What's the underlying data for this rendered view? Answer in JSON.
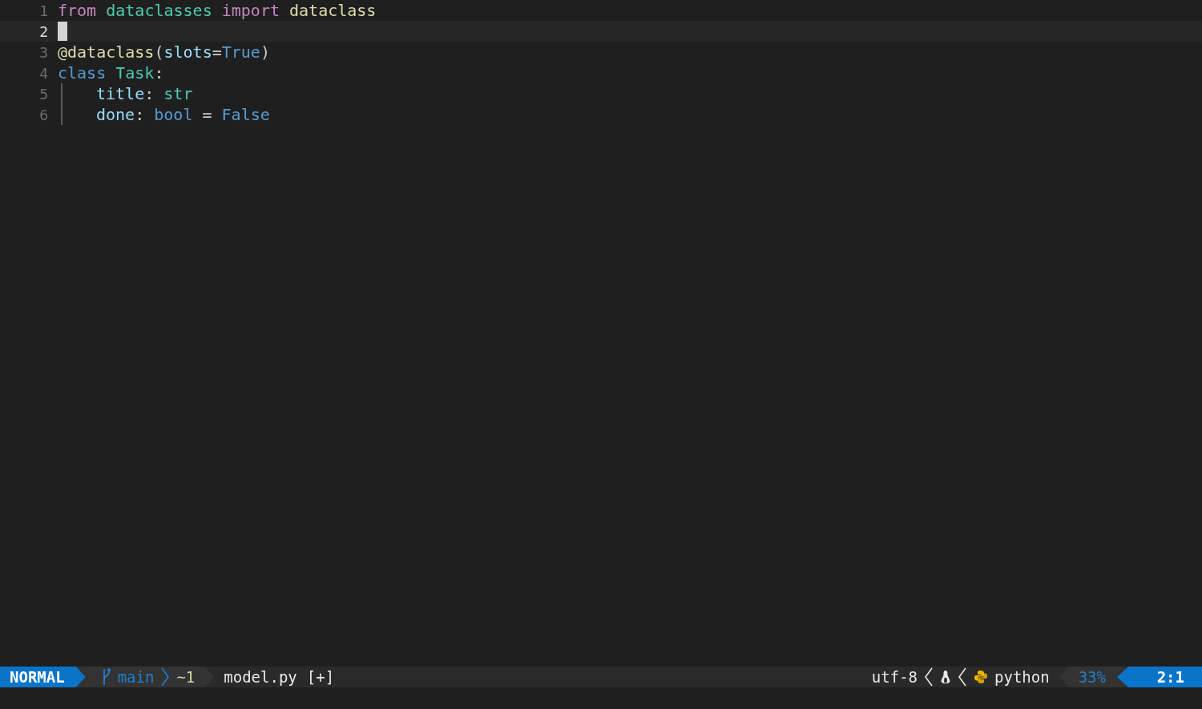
{
  "lines": [
    {
      "number": "1",
      "current": false,
      "indented": false,
      "tokens": [
        {
          "text": "from ",
          "kind": "keyword"
        },
        {
          "text": "dataclasses ",
          "kind": "module"
        },
        {
          "text": "import ",
          "kind": "keyword"
        },
        {
          "text": "dataclass",
          "kind": "function"
        }
      ]
    },
    {
      "number": "2",
      "current": true,
      "indented": false
    },
    {
      "number": "3",
      "current": false,
      "indented": false,
      "tokens": [
        {
          "text": "@dataclass",
          "kind": "function"
        },
        {
          "text": "(",
          "kind": "plain"
        },
        {
          "text": "slots",
          "kind": "variable"
        },
        {
          "text": "=",
          "kind": "plain"
        },
        {
          "text": "True",
          "kind": "constant"
        },
        {
          "text": ")",
          "kind": "plain"
        }
      ]
    },
    {
      "number": "4",
      "current": false,
      "indented": false,
      "tokens": [
        {
          "text": "class ",
          "kind": "constant"
        },
        {
          "text": "Task",
          "kind": "module"
        },
        {
          "text": ":",
          "kind": "plain"
        }
      ]
    },
    {
      "number": "5",
      "current": false,
      "indented": true,
      "tokens": [
        {
          "text": "title",
          "kind": "variable"
        },
        {
          "text": ": ",
          "kind": "plain"
        },
        {
          "text": "str",
          "kind": "module"
        }
      ]
    },
    {
      "number": "6",
      "current": false,
      "indented": true,
      "tokens": [
        {
          "text": "done",
          "kind": "variable"
        },
        {
          "text": ": ",
          "kind": "plain"
        },
        {
          "text": "bool",
          "kind": "constant"
        },
        {
          "text": " = ",
          "kind": "plain"
        },
        {
          "text": "False",
          "kind": "constant"
        }
      ]
    }
  ],
  "status_bar": {
    "mode": "NORMAL",
    "branch": "main",
    "changes": "~1",
    "file": "model.py",
    "modified": "[+]",
    "encoding": "utf-8",
    "filetype": "python",
    "progress": "33%",
    "position": "2:1"
  }
}
